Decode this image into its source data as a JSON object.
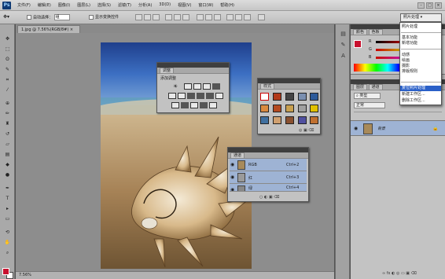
{
  "app": {
    "logo": "Ps",
    "accent": "#0f3a74"
  },
  "menu": [
    "文件(F)",
    "编辑(E)",
    "图像(I)",
    "图层(L)",
    "选择(S)",
    "滤镜(T)",
    "分析(A)",
    "3D(D)",
    "视图(V)",
    "窗口(W)",
    "帮助(H)"
  ],
  "window_controls": [
    "-",
    "□",
    "×"
  ],
  "options": {
    "auto_select_label": "自动选择：",
    "auto_select_value": "组",
    "show_transform_label": "显示变换控件"
  },
  "workspace": {
    "current": "照片处理",
    "items": [
      "照片处理",
      "基本功能",
      "新增功能",
      "动感",
      "绘画",
      "摄影",
      "排版规则",
      "复位照片处理",
      "新建工作区...",
      "删除工作区..."
    ],
    "highlighted": "复位照片处理"
  },
  "document": {
    "tab_label": "1.jpg @ 7.56%(RGB/8#)",
    "zoom": "7.56%"
  },
  "adjust_panel": {
    "title": "调整",
    "subtitle": "添加调整"
  },
  "styles_panel": {
    "title": "样式"
  },
  "channels_panel": {
    "title": "通道",
    "rows": [
      {
        "name": "RGB",
        "shortcut": "Ctrl+2"
      },
      {
        "name": "红",
        "shortcut": "Ctrl+3"
      },
      {
        "name": "绿",
        "shortcut": "Ctrl+4"
      }
    ]
  },
  "color_panel": {
    "tabs": [
      "颜色",
      "色板"
    ],
    "labels": [
      "R",
      "G",
      "B"
    ],
    "foreground": "#c8102e"
  },
  "layers_panel": {
    "tabs": [
      "图层",
      "通道"
    ],
    "filter": "类型",
    "blend_mode": "正常",
    "layer_name": "背景"
  }
}
